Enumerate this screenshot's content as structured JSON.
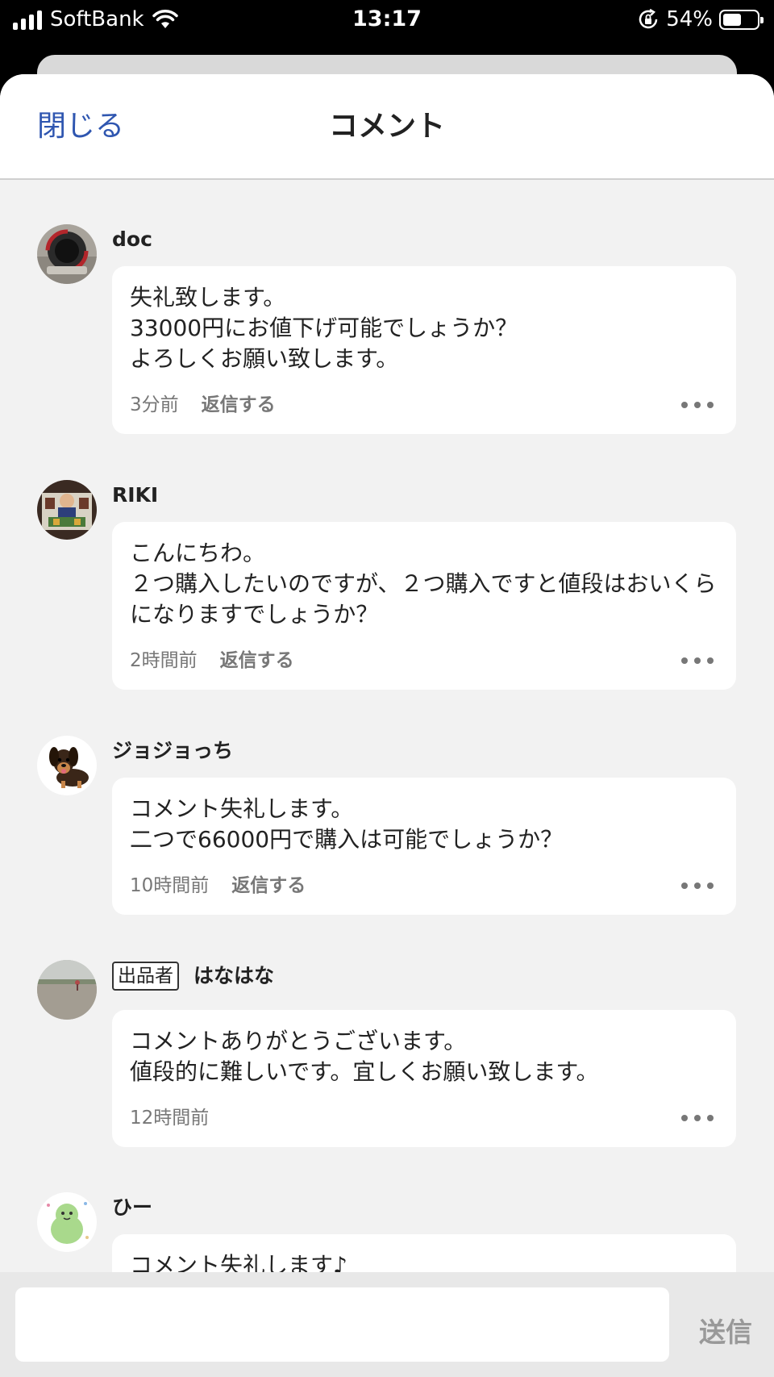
{
  "status_bar": {
    "carrier": "SoftBank",
    "time": "13:17",
    "battery_percent": "54%",
    "battery_level": 0.54
  },
  "header": {
    "close_label": "閉じる",
    "title": "コメント"
  },
  "comments": [
    {
      "username": "doc",
      "text": "失礼致します。\n33000円にお値下げ可能でしょうか？\nよろしくお願い致します。",
      "time": "3分前",
      "reply_label": "返信する"
    },
    {
      "username": "RIKI",
      "text": "こんにちわ。\n２つ購入したいのですが、２つ購入ですと値段はおいくらになりますでしょうか？",
      "time": "2時間前",
      "reply_label": "返信する"
    },
    {
      "username": "ジョジョっち",
      "text": "コメント失礼します。\n二つで66000円で購入は可能でしょうか？",
      "time": "10時間前",
      "reply_label": "返信する"
    },
    {
      "seller_badge": "出品者",
      "username": "はなはな",
      "text": "コメントありがとうございます。\n値段的に難しいです。宜しくお願い致します。",
      "time": "12時間前"
    },
    {
      "username": "ひー",
      "text": "コメント失礼します♪"
    }
  ],
  "composer": {
    "placeholder": "",
    "send_label": "送信"
  }
}
